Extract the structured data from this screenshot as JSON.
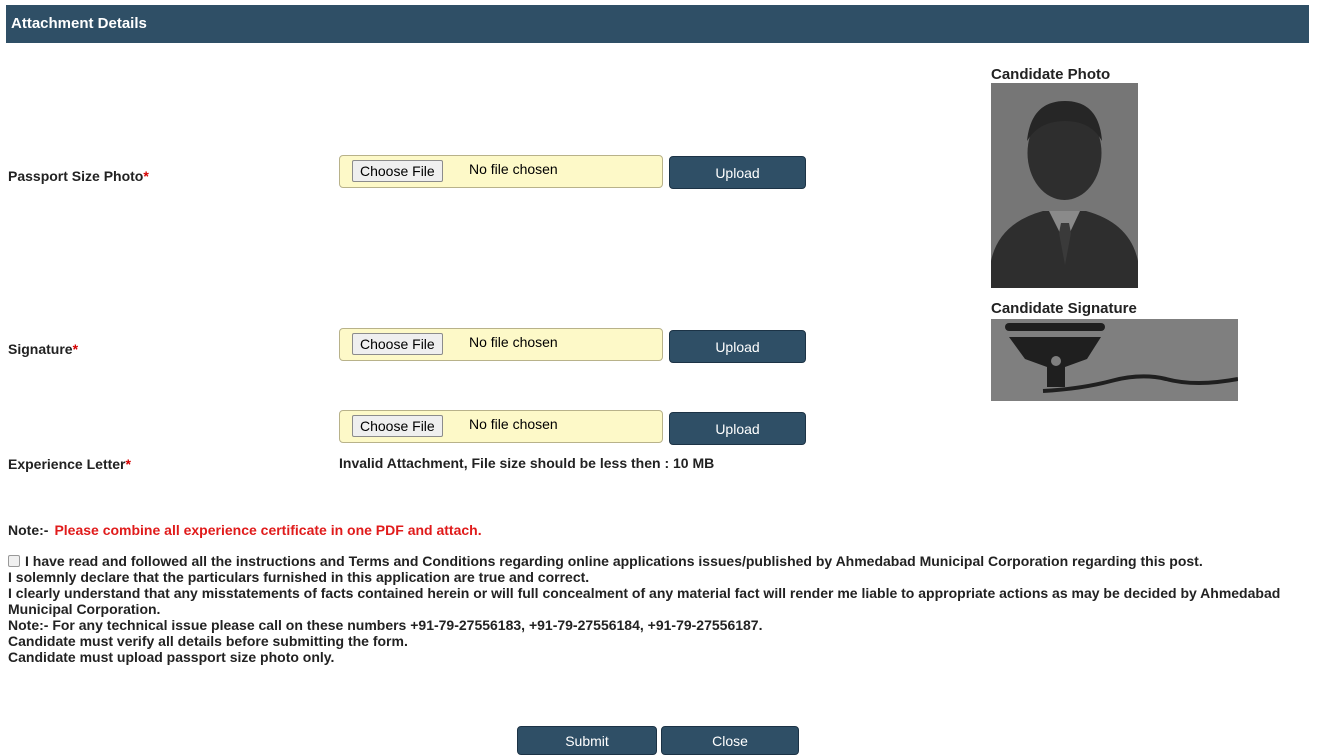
{
  "header": {
    "title": "Attachment Details"
  },
  "fields": [
    {
      "label": "Passport Size Photo",
      "required_mark": "*",
      "choose_label": "Choose File",
      "file_status": "No file chosen",
      "upload_label": "Upload"
    },
    {
      "label": "Signature",
      "required_mark": "*",
      "choose_label": "Choose File",
      "file_status": "No file chosen",
      "upload_label": "Upload"
    },
    {
      "label": "Experience Letter",
      "required_mark": "*",
      "choose_label": "Choose File",
      "file_status": "No file chosen",
      "upload_label": "Upload",
      "error": "Invalid Attachment, File size should be less then : 10 MB"
    }
  ],
  "preview": {
    "photo_title": "Candidate Photo",
    "signature_title": "Candidate Signature"
  },
  "note": {
    "label": "Note:-",
    "text": "Please combine all experience certificate in one PDF and attach."
  },
  "declaration": {
    "checked": false,
    "lines": [
      "I have read and followed all the instructions and Terms and Conditions regarding online applications issues/published by Ahmedabad Municipal Corporation regarding this post.",
      "I solemnly declare that the particulars furnished in this application are true and correct.",
      "I clearly understand that any misstatements of facts contained herein or will full concealment of any material fact will render me liable to appropriate actions as may be decided by Ahmedabad Municipal Corporation.",
      "Note:- For any technical issue please call on these numbers +91-79-27556183, +91-79-27556184, +91-79-27556187.",
      "Candidate must verify all details before submitting the form.",
      "Candidate must upload passport size photo only."
    ]
  },
  "actions": {
    "submit_label": "Submit",
    "close_label": "Close"
  },
  "colors": {
    "header_bg": "#2f4f66",
    "button_bg": "#2f4f66",
    "file_bg": "#fdf9c8",
    "required": "#d40000",
    "note_red": "#e01b1b"
  }
}
